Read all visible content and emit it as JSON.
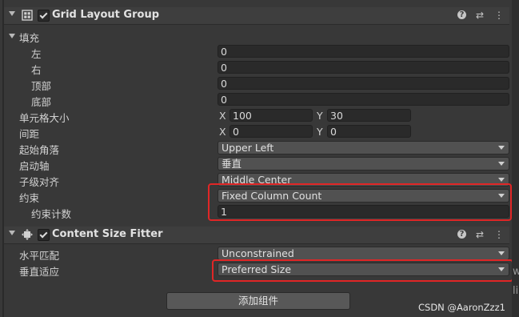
{
  "grid_layout_group": {
    "title": "Grid Layout Group",
    "padding": {
      "label": "填充",
      "left_label": "左",
      "left_value": "0",
      "right_label": "右",
      "right_value": "0",
      "top_label": "顶部",
      "top_value": "0",
      "bottom_label": "底部",
      "bottom_value": "0"
    },
    "cell_size": {
      "label": "单元格大小",
      "x_label": "X",
      "x_value": "100",
      "y_label": "Y",
      "y_value": "30"
    },
    "spacing": {
      "label": "间距",
      "x_label": "X",
      "x_value": "0",
      "y_label": "Y",
      "y_value": "0"
    },
    "start_corner": {
      "label": "起始角落",
      "value": "Upper Left"
    },
    "start_axis": {
      "label": "启动轴",
      "value": "垂直"
    },
    "child_alignment": {
      "label": "子级对齐",
      "value": "Middle Center"
    },
    "constraint": {
      "label": "约束",
      "value": "Fixed Column Count"
    },
    "constraint_count": {
      "label": "约束计数",
      "value": "1"
    }
  },
  "content_size_fitter": {
    "title": "Content Size Fitter",
    "horizontal_fit": {
      "label": "水平匹配",
      "value": "Unconstrained"
    },
    "vertical_fit": {
      "label": "垂直适应",
      "value": "Preferred Size"
    }
  },
  "add_component_label": "添加组件",
  "header_icons": [
    "help-icon",
    "preset-icon",
    "more-icon"
  ],
  "stray_text": {
    "top": "w",
    "bottom": "li"
  },
  "watermark": "CSDN @AaronZzz1",
  "colors": {
    "highlight_border": "#e02626",
    "background": "#383838",
    "field": "#2a2a2a",
    "dropdown": "#515151"
  }
}
